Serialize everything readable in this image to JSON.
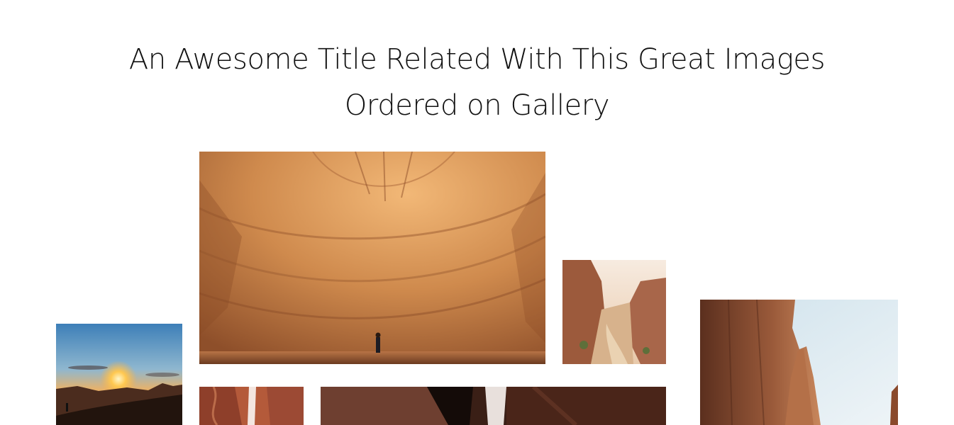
{
  "header": {
    "title_line1": "An Awesome Title Related With This Great Images",
    "title_line2": "Ordered on Gallery"
  },
  "gallery": {
    "items": [
      {
        "id": "sunset",
        "subject": "desert sunset with hiker"
      },
      {
        "id": "canyon",
        "subject": "giant sandstone cave wall with hiker"
      },
      {
        "id": "valley",
        "subject": "rocky canyon valley path"
      },
      {
        "id": "cliffs",
        "subject": "towering sandstone cliffs against sky"
      },
      {
        "id": "slot-a",
        "subject": "red slot canyon"
      },
      {
        "id": "slot-b",
        "subject": "dark slot canyon walls"
      }
    ]
  },
  "colors": {
    "background": "#ffffff",
    "title": "#111111",
    "sandstone": "#c9874a",
    "sky": "#7fb3d8",
    "shadow": "#3a1f16"
  }
}
